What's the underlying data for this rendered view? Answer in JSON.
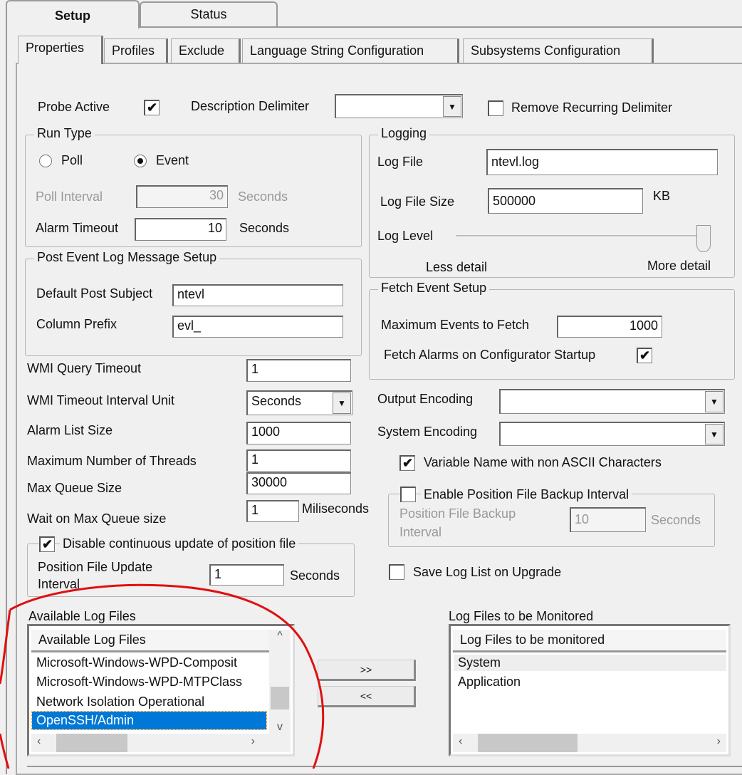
{
  "outer_tabs": [
    "Setup",
    "Status"
  ],
  "inner_tabs": [
    "Properties",
    "Profiles",
    "Exclude",
    "Language String Configuration",
    "Subsystems Configuration"
  ],
  "top": {
    "probe_active": "Probe Active",
    "probe_active_checked": true,
    "description_delimiter": "Description Delimiter",
    "description_delimiter_value": "",
    "remove_recurring": "Remove Recurring Delimiter",
    "remove_recurring_checked": false
  },
  "run_type": {
    "title": "Run Type",
    "poll": "Poll",
    "event": "Event",
    "selected": "Event",
    "poll_interval": "Poll Interval",
    "poll_interval_value": "30",
    "seconds": "Seconds",
    "alarm_timeout": "Alarm Timeout",
    "alarm_timeout_value": "10"
  },
  "post_event": {
    "title": "Post Event Log Message Setup",
    "default_post_subject": "Default Post Subject",
    "default_post_subject_value": "ntevl",
    "column_prefix": "Column Prefix",
    "column_prefix_value": "evl_"
  },
  "logging": {
    "title": "Logging",
    "log_file": "Log File",
    "log_file_value": "ntevl.log",
    "log_file_size": "Log File Size",
    "log_file_size_value": "500000",
    "kb": "KB",
    "log_level": "Log Level",
    "log_level_fraction": 1.0,
    "less": "Less detail",
    "more": "More detail"
  },
  "fetch": {
    "title": "Fetch Event Setup",
    "max_events": "Maximum Events to Fetch",
    "max_events_value": "1000",
    "fetch_alarms": "Fetch Alarms on Configurator Startup",
    "fetch_alarms_checked": true
  },
  "wmi": {
    "query_timeout": "WMI Query Timeout",
    "query_timeout_value": "1",
    "interval_unit": "WMI Timeout Interval Unit",
    "interval_unit_value": "Seconds",
    "alarm_list_size": "Alarm List Size",
    "alarm_list_size_value": "1000",
    "max_threads": "Maximum Number of Threads",
    "max_threads_value": "1",
    "max_queue": "Max Queue Size",
    "max_queue_value": "30000",
    "wait_queue": "Wait on Max Queue size",
    "wait_queue_value": "1",
    "miliseconds": "Miliseconds"
  },
  "position": {
    "disable_continuous": "Disable continuous update of position file",
    "disable_checked": true,
    "update_interval_1": "Position File Update",
    "update_interval_2": "Interval",
    "update_interval_value": "1",
    "seconds": "Seconds"
  },
  "encoding": {
    "output": "Output Encoding",
    "output_value": "",
    "system": "System Encoding",
    "system_value": "",
    "variable_name": "Variable Name with non ASCII Characters",
    "variable_checked": true
  },
  "backup": {
    "enable": "Enable Position File Backup Interval",
    "enable_checked": false,
    "interval_1": "Position File Backup",
    "interval_2": "Interval",
    "value": "10",
    "seconds": "Seconds"
  },
  "save_log_list": "Save Log List on Upgrade",
  "available": {
    "label": "Available Log Files",
    "header": "Available Log Files",
    "items": [
      "Microsoft-Windows-WPD-Composit",
      "Microsoft-Windows-WPD-MTPClass",
      "Network Isolation Operational",
      "OpenSSH/Admin"
    ],
    "selected": "OpenSSH/Admin"
  },
  "buttons": {
    "add": ">>",
    "remove": "<<"
  },
  "monitored": {
    "label": "Log Files to be Monitored",
    "header": "Log Files to be monitored",
    "items": [
      "System",
      "Application"
    ]
  },
  "colors": {
    "selection": "#0078d7",
    "annotation": "#e01010"
  }
}
